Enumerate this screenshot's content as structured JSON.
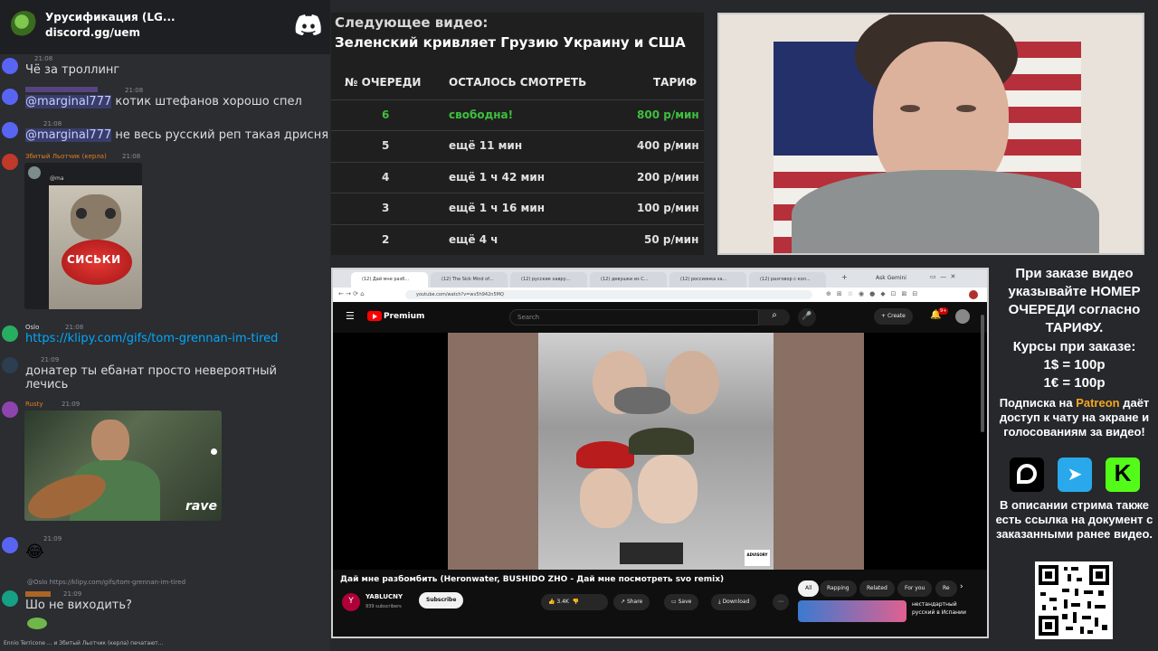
{
  "discord": {
    "server_name": "Урусификация (LG...",
    "server_link": "discord.gg/uem",
    "messages": [
      {
        "user": "",
        "time": "21:08",
        "text": "Чё за троллинг"
      },
      {
        "user": "",
        "time": "21:08",
        "mention": "@marginal777",
        "text": " котик штефанов хорошо спел"
      },
      {
        "user": "",
        "time": "21:08",
        "mention": "@marginal777",
        "text": " не весь русский реп такая дрисня"
      },
      {
        "user": "Збитый Льотчик (керла)",
        "time": "21:08",
        "embed_caption": "СИСЬКИ"
      },
      {
        "user": "Oslo",
        "time": "21:08",
        "link": "https://klipy.com/gifs/tom-grennan-im-tired"
      },
      {
        "user": "",
        "time": "21:09",
        "text": "донатер ты ебанат просто невероятный",
        "text2": "лечись"
      },
      {
        "user": "Rusty",
        "time": "21:09",
        "embed_brand": "rave"
      },
      {
        "user": "",
        "time": "21:09",
        "text": "😂"
      },
      {
        "user": "",
        "time": "21:09",
        "reply": "@Oslo https://klipy.com/gifs/tom-grennan-im-tired",
        "text": "Шо не виходить?"
      }
    ],
    "typing": "Ennio Terricone ... и Збитый Льотчик (керла) печатают..."
  },
  "queue": {
    "next_label": "Следующее видео:",
    "next_title": "Зеленский кривляет Грузию Украину и США",
    "headers": [
      "№ ОЧЕРЕДИ",
      "ОСТАЛОСЬ СМОТРЕТЬ",
      "ТАРИФ"
    ],
    "rows": [
      {
        "num": "6",
        "left": "свободна!",
        "price": "800 р/мин",
        "highlight": true
      },
      {
        "num": "5",
        "left": "ещё 11 мин",
        "price": "400 р/мин",
        "highlight": false
      },
      {
        "num": "4",
        "left": "ещё 1 ч 42 мин",
        "price": "200 р/мин",
        "highlight": false
      },
      {
        "num": "3",
        "left": "ещё 1 ч 16 мин",
        "price": "100 р/мин",
        "highlight": false
      },
      {
        "num": "2",
        "left": "ещё 4 ч",
        "price": "50 р/мин",
        "highlight": false
      }
    ],
    "green": "#3fbf3f"
  },
  "browser": {
    "tabs": [
      "(12) Дай мне разб...",
      "(12) The Sick Mind of...",
      "(12) русские хавру...",
      "(12) девушки из С...",
      "(12) россиянка за...",
      "(12) разговор с кол..."
    ],
    "ask_gemini": "Ask Gemini",
    "url": "youtube.com/watch?v=wv5h942n5MQ",
    "brand": "Premium",
    "search_placeholder": "Search",
    "create": "Create",
    "notif_count": "9+",
    "video_title": "Дай мне разбомбить (Heronwater, BUSHIDO ZHO - Дай мне посмотреть svo remix)",
    "channel": "YABLUCNY",
    "subs": "939 subscribers",
    "subscribe": "Subscribe",
    "likes": "3.4K",
    "share": "Share",
    "save": "Save",
    "download": "Download",
    "chips": [
      "All",
      "Rapping",
      "Related",
      "For you",
      "Re"
    ],
    "rec_title_1": "нестандартный",
    "rec_title_2": "русский в Испании"
  },
  "info": {
    "line1": "При заказе видео указывайте НОМЕР ОЧЕРЕДИ согласно ТАРИФУ.",
    "line2": "Курсы при заказе:",
    "usd": "1$ = 100р",
    "eur": "1€ = 100р",
    "sub_pre": "Подписка на ",
    "patreon": "Patreon",
    "sub_post": " даёт доступ к чату на экране и голосованиям за видео!",
    "bottom": "В описании стрима также есть ссылка на документ с заказанными ранее видео.",
    "patreon_color": "#f5a623"
  }
}
